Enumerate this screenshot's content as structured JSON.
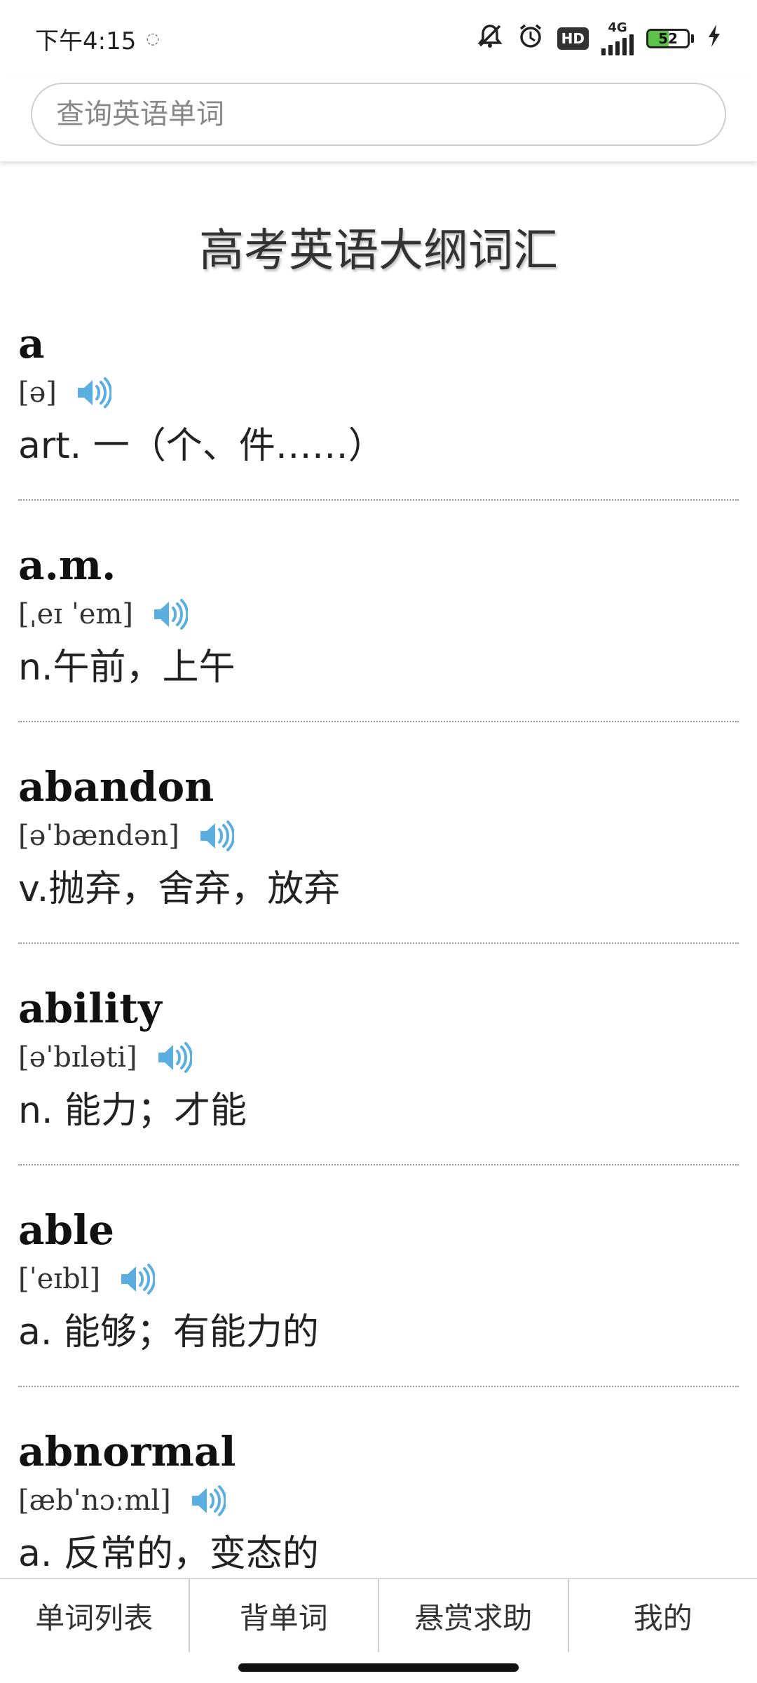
{
  "status_bar": {
    "time": "下午4:15",
    "network": "4G",
    "hd_badge": "HD",
    "battery_level": "52",
    "battery_fraction": 0.52,
    "icons": [
      "alarm-off-icon",
      "alarm-clock-icon",
      "hd-icon",
      "signal-icon",
      "battery-icon",
      "charging-icon"
    ]
  },
  "search": {
    "placeholder": "查询英语单词"
  },
  "page": {
    "title": "高考英语大纲词汇"
  },
  "words": [
    {
      "word": "a",
      "phonetic": "[ə]",
      "meaning": "art. 一（个、件……）"
    },
    {
      "word": "a.m.",
      "phonetic": "[ˌeɪ ˈem]",
      "meaning": "n.午前，上午"
    },
    {
      "word": "abandon",
      "phonetic": "[əˈbændən]",
      "meaning": "v.抛弃，舍弃，放弃"
    },
    {
      "word": "ability",
      "phonetic": "[əˈbɪləti]",
      "meaning": "n. 能力；才能"
    },
    {
      "word": "able",
      "phonetic": "[ˈeɪbl]",
      "meaning": "a. 能够；有能力的"
    },
    {
      "word": "abnormal",
      "phonetic": "[æbˈnɔːml]",
      "meaning": "a. 反常的，变态的"
    }
  ],
  "colors": {
    "speaker_icon": "#5aaee0",
    "battery_fill": "#5cc24a"
  },
  "bottom_nav": [
    {
      "label": "单词列表"
    },
    {
      "label": "背单词"
    },
    {
      "label": "悬赏求助"
    },
    {
      "label": "我的"
    }
  ]
}
